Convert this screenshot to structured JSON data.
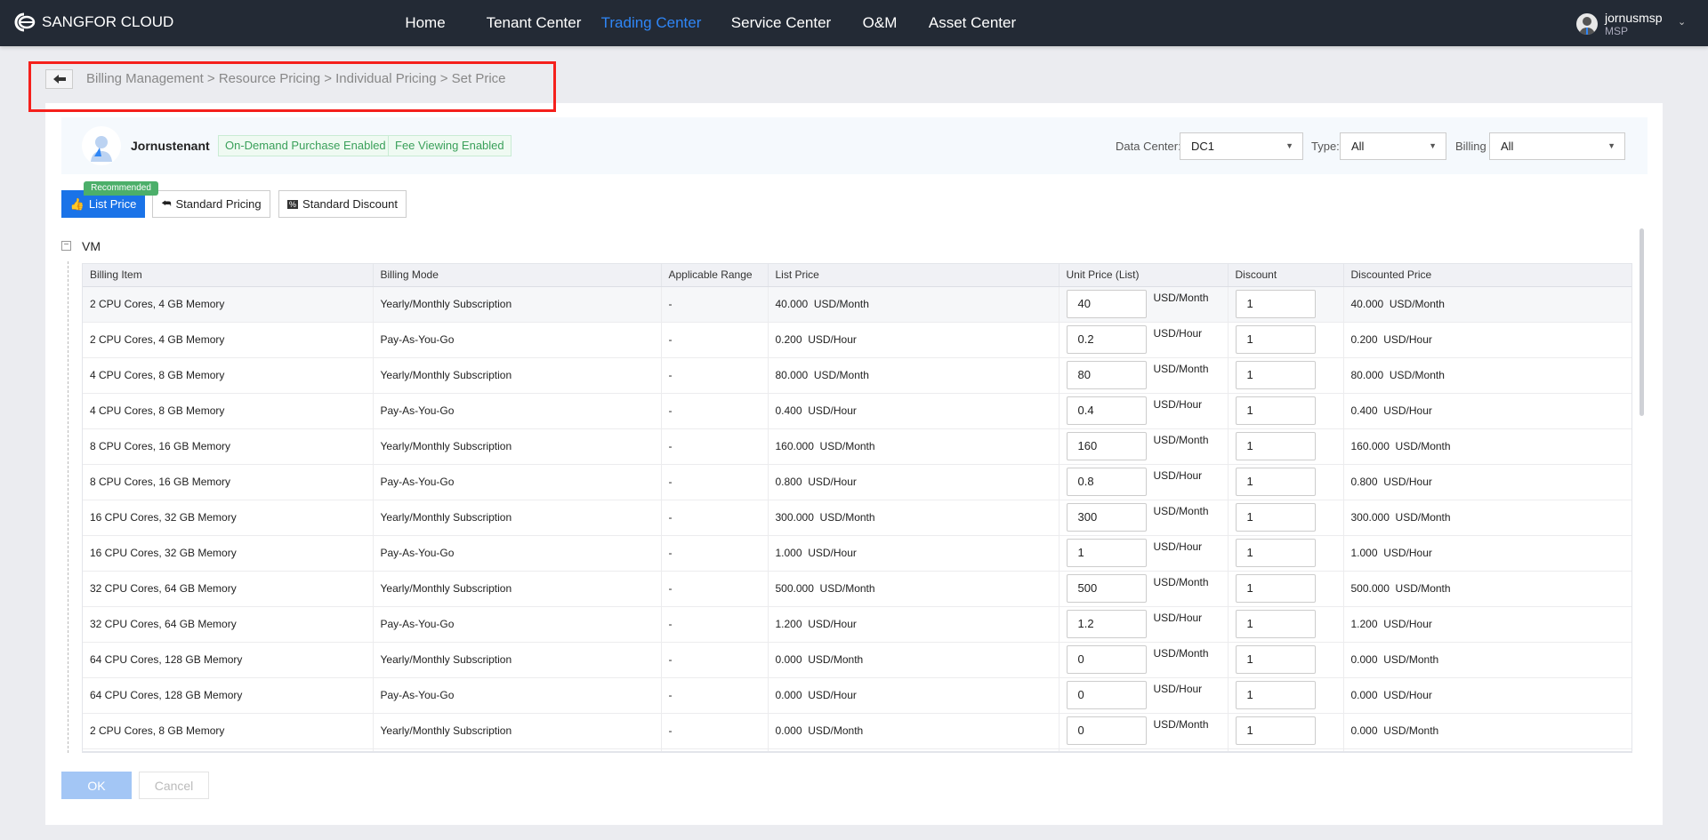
{
  "header": {
    "brand": "SANGFOR CLOUD",
    "nav": [
      {
        "label": "Home"
      },
      {
        "label": "Tenant Center"
      },
      {
        "label": "Trading Center",
        "active": true
      },
      {
        "label": "Service Center"
      },
      {
        "label": "O&M"
      },
      {
        "label": "Asset Center"
      }
    ],
    "user": {
      "name": "jornusmsp",
      "role": "MSP"
    },
    "accent": "#2f86f6"
  },
  "breadcrumb": {
    "text": "Billing Management > Resource Pricing > Individual Pricing > Set Price"
  },
  "tenant": {
    "name": "Jornustenant",
    "tags": [
      "On-Demand Purchase Enabled",
      "Fee Viewing Enabled"
    ]
  },
  "filters": {
    "data_center_label": "Data Center:",
    "data_center": "DC1",
    "type_label": "Type:",
    "type": "All",
    "billing_mode_label": "Billing Mode:",
    "billing_mode": "All"
  },
  "pricing_buttons": {
    "recommended": "Recommended",
    "list_price": "List Price",
    "standard_pricing": "Standard Pricing",
    "standard_discount": "Standard Discount"
  },
  "section": {
    "title": "VM",
    "toggle": "−"
  },
  "table": {
    "columns": [
      "Billing Item",
      "Billing Mode",
      "Applicable Range",
      "List Price",
      "Unit Price (List)",
      "Discount",
      "Discounted Price"
    ],
    "rows": [
      {
        "item": "2 CPU Cores, 4 GB Memory",
        "mode": "Yearly/Monthly Subscription",
        "range": "-",
        "list": "40.000  USD/Month",
        "unit_price": "40",
        "unit": "USD/Month",
        "discount": "1",
        "discounted": "40.000  USD/Month"
      },
      {
        "item": "2 CPU Cores, 4 GB Memory",
        "mode": "Pay-As-You-Go",
        "range": "-",
        "list": "0.200  USD/Hour",
        "unit_price": "0.2",
        "unit": "USD/Hour",
        "discount": "1",
        "discounted": "0.200  USD/Hour"
      },
      {
        "item": "4 CPU Cores, 8 GB Memory",
        "mode": "Yearly/Monthly Subscription",
        "range": "-",
        "list": "80.000  USD/Month",
        "unit_price": "80",
        "unit": "USD/Month",
        "discount": "1",
        "discounted": "80.000  USD/Month"
      },
      {
        "item": "4 CPU Cores, 8 GB Memory",
        "mode": "Pay-As-You-Go",
        "range": "-",
        "list": "0.400  USD/Hour",
        "unit_price": "0.4",
        "unit": "USD/Hour",
        "discount": "1",
        "discounted": "0.400  USD/Hour"
      },
      {
        "item": "8 CPU Cores, 16 GB Memory",
        "mode": "Yearly/Monthly Subscription",
        "range": "-",
        "list": "160.000  USD/Month",
        "unit_price": "160",
        "unit": "USD/Month",
        "discount": "1",
        "discounted": "160.000  USD/Month"
      },
      {
        "item": "8 CPU Cores, 16 GB Memory",
        "mode": "Pay-As-You-Go",
        "range": "-",
        "list": "0.800  USD/Hour",
        "unit_price": "0.8",
        "unit": "USD/Hour",
        "discount": "1",
        "discounted": "0.800  USD/Hour"
      },
      {
        "item": "16 CPU Cores, 32 GB Memory",
        "mode": "Yearly/Monthly Subscription",
        "range": "-",
        "list": "300.000  USD/Month",
        "unit_price": "300",
        "unit": "USD/Month",
        "discount": "1",
        "discounted": "300.000  USD/Month"
      },
      {
        "item": "16 CPU Cores, 32 GB Memory",
        "mode": "Pay-As-You-Go",
        "range": "-",
        "list": "1.000  USD/Hour",
        "unit_price": "1",
        "unit": "USD/Hour",
        "discount": "1",
        "discounted": "1.000  USD/Hour"
      },
      {
        "item": "32 CPU Cores, 64 GB Memory",
        "mode": "Yearly/Monthly Subscription",
        "range": "-",
        "list": "500.000  USD/Month",
        "unit_price": "500",
        "unit": "USD/Month",
        "discount": "1",
        "discounted": "500.000  USD/Month"
      },
      {
        "item": "32 CPU Cores, 64 GB Memory",
        "mode": "Pay-As-You-Go",
        "range": "-",
        "list": "1.200  USD/Hour",
        "unit_price": "1.2",
        "unit": "USD/Hour",
        "discount": "1",
        "discounted": "1.200  USD/Hour"
      },
      {
        "item": "64 CPU Cores, 128 GB Memory",
        "mode": "Yearly/Monthly Subscription",
        "range": "-",
        "list": "0.000  USD/Month",
        "unit_price": "0",
        "unit": "USD/Month",
        "discount": "1",
        "discounted": "0.000  USD/Month"
      },
      {
        "item": "64 CPU Cores, 128 GB Memory",
        "mode": "Pay-As-You-Go",
        "range": "-",
        "list": "0.000  USD/Hour",
        "unit_price": "0",
        "unit": "USD/Hour",
        "discount": "1",
        "discounted": "0.000  USD/Hour"
      },
      {
        "item": "2 CPU Cores, 8 GB Memory",
        "mode": "Yearly/Monthly Subscription",
        "range": "-",
        "list": "0.000  USD/Month",
        "unit_price": "0",
        "unit": "USD/Month",
        "discount": "1",
        "discounted": "0.000  USD/Month"
      }
    ]
  },
  "footer": {
    "ok": "OK",
    "cancel": "Cancel"
  }
}
